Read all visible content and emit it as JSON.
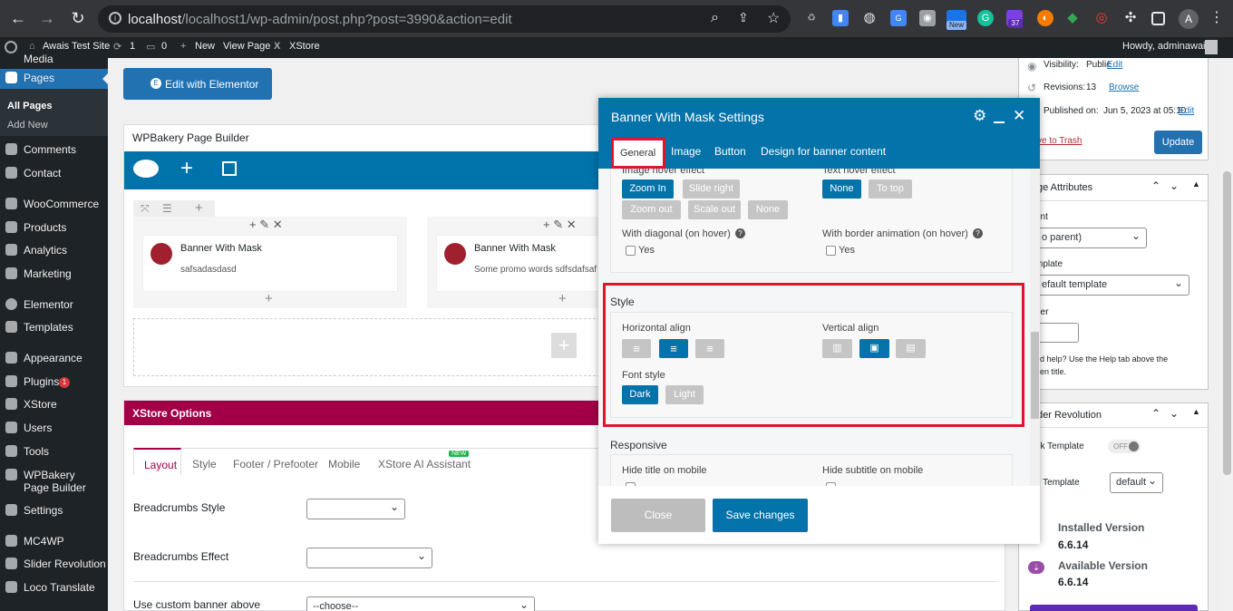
{
  "browser": {
    "url_host": "localhost",
    "url_path": "/localhost1/wp-admin/post.php?post=3990&action=edit",
    "profile_initial": "A",
    "ext_badge_37": "37",
    "ext_new": "New"
  },
  "adminbar": {
    "site": "Awais Test Site",
    "updates": "1",
    "comments": "0",
    "new": "New",
    "view_page": "View Page",
    "xstore": "XStore",
    "howdy": "Howdy, adminawais"
  },
  "sidebar": {
    "media": "Media",
    "pages": "Pages",
    "all_pages": "All Pages",
    "add_new": "Add New",
    "items": [
      "Comments",
      "Contact",
      "WooCommerce",
      "Products",
      "Analytics",
      "Marketing",
      "Elementor",
      "Templates",
      "Appearance",
      "Plugins",
      "XStore",
      "Users",
      "Tools",
      "WPBakery Page Builder",
      "Settings",
      "MC4WP",
      "Slider Revolution",
      "Loco Translate"
    ],
    "plugins_badge": "1"
  },
  "main": {
    "edit_elementor": "Edit with Elementor",
    "wpb_title": "WPBakery Page Builder",
    "el1": {
      "title": "Banner With Mask",
      "text": "safsadasdasd"
    },
    "el2": {
      "title": "Banner With Mask",
      "text": "Some promo words sdfsdafsaf"
    },
    "xstore_title": "XStore Options",
    "xstore_tabs": [
      "Layout",
      "Style",
      "Footer / Prefooter",
      "Mobile",
      "XStore AI Assistant"
    ],
    "new_badge": "NEW",
    "breadcrumbs_style": "Breadcrumbs Style",
    "breadcrumbs_effect": "Breadcrumbs Effect",
    "custom_banner": "Use custom banner above",
    "choose": "--choose--"
  },
  "right": {
    "visibility_label": "Visibility:",
    "visibility_value": "Public",
    "visibility_edit": "Edit",
    "revisions_label": "Revisions:",
    "revisions_value": "13",
    "revisions_browse": "Browse",
    "published_label": "Published on:",
    "published_value": "Jun 5, 2023 at 05:10",
    "published_edit": "Edit",
    "trash": "ve to Trash",
    "update": "Update",
    "page_attr": "ge Attributes",
    "parent_label": "ent",
    "parent_value": "o parent)",
    "template_label": "mplate",
    "template_value": "efault template",
    "order_label": "der",
    "help": "ed help? Use the Help tab above the",
    "help2": "een title.",
    "slider_title": "der Revolution",
    "blank_tpl": "nk Template",
    "toggle_off": "OFF",
    "tpl_label": "e Template",
    "tpl_value": "default",
    "installed_label": "Installed Version",
    "installed_value": "6.6.14",
    "available_label": "Available Version",
    "available_value": "6.6.14"
  },
  "modal": {
    "title": "Banner With Mask Settings",
    "tabs": [
      "General",
      "Image",
      "Button",
      "Design for banner content"
    ],
    "image_hover_effect": "Image hover effect",
    "image_hover": [
      "Zoom In",
      "Slide right",
      "Zoom out",
      "Scale out",
      "None"
    ],
    "text_hover_effect": "Text hover effect",
    "text_hover": [
      "None",
      "To top"
    ],
    "diagonal": "With diagonal (on hover)",
    "border_anim": "With border animation (on hover)",
    "yes": "Yes",
    "style_title": "Style",
    "h_align": "Horizontal align",
    "v_align": "Vertical align",
    "font_style": "Font style",
    "font_styles": [
      "Dark",
      "Light"
    ],
    "responsive_title": "Responsive",
    "hide_title": "Hide title on mobile",
    "hide_subtitle": "Hide subtitle on mobile",
    "close": "Close",
    "save": "Save changes"
  }
}
